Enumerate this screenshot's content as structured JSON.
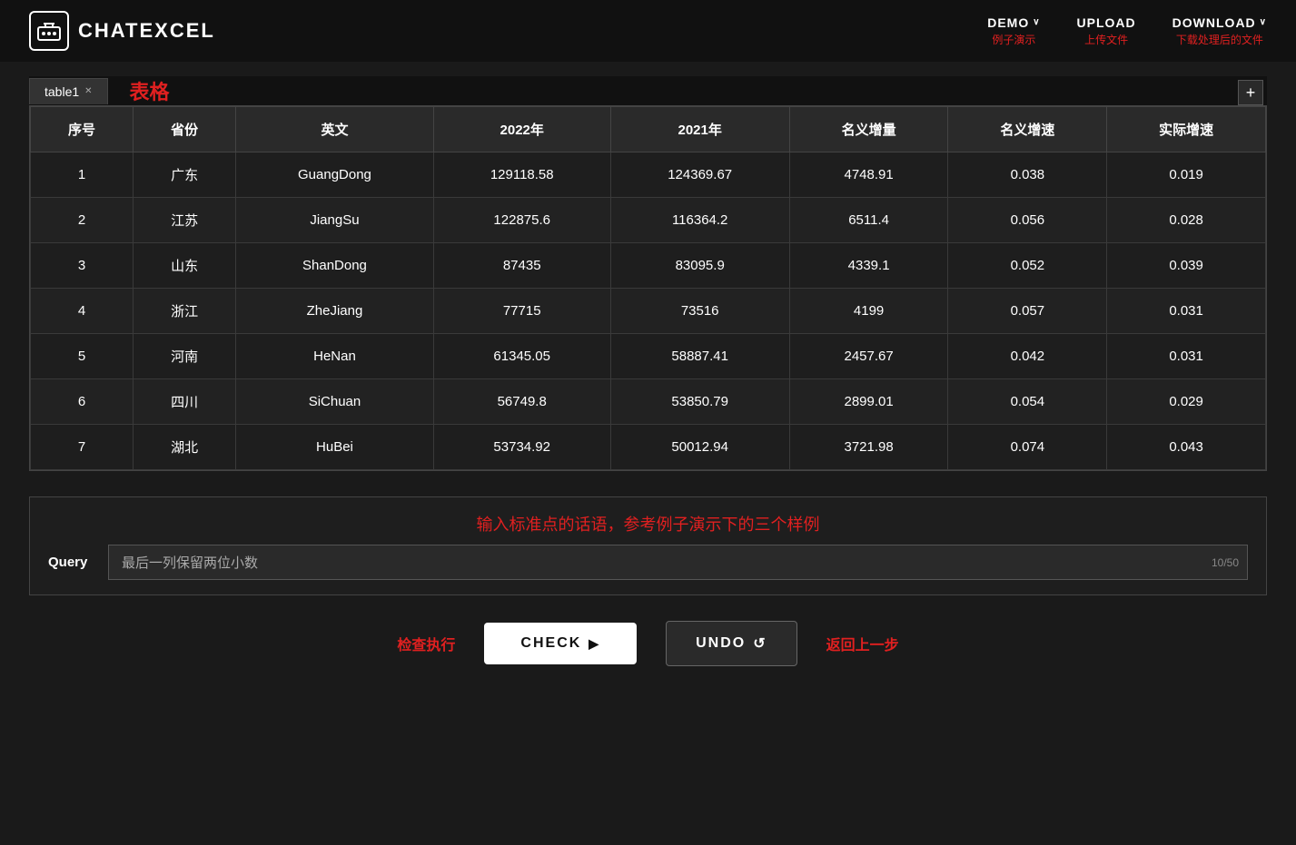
{
  "header": {
    "logo_text": "ChatExcel",
    "nav": [
      {
        "id": "demo",
        "label": "DEMO",
        "has_chevron": true,
        "sub": "例子演示"
      },
      {
        "id": "upload",
        "label": "UPLOAD",
        "has_chevron": false,
        "sub": "上传文件"
      },
      {
        "id": "download",
        "label": "DOWNLOAD",
        "has_chevron": true,
        "sub": "下载处理后的文件"
      }
    ]
  },
  "tabs": [
    {
      "id": "table1",
      "label": "table1",
      "active": true
    }
  ],
  "section_title": "表格",
  "add_tab_label": "+",
  "table": {
    "columns": [
      "序号",
      "省份",
      "英文",
      "2022年",
      "2021年",
      "名义增量",
      "名义增速",
      "实际增速"
    ],
    "rows": [
      [
        "1",
        "广东",
        "GuangDong",
        "129118.58",
        "124369.67",
        "4748.91",
        "0.038",
        "0.019"
      ],
      [
        "2",
        "江苏",
        "JiangSu",
        "122875.6",
        "116364.2",
        "6511.4",
        "0.056",
        "0.028"
      ],
      [
        "3",
        "山东",
        "ShanDong",
        "87435",
        "83095.9",
        "4339.1",
        "0.052",
        "0.039"
      ],
      [
        "4",
        "浙江",
        "ZheJiang",
        "77715",
        "73516",
        "4199",
        "0.057",
        "0.031"
      ],
      [
        "5",
        "河南",
        "HeNan",
        "61345.05",
        "58887.41",
        "2457.67",
        "0.042",
        "0.031"
      ],
      [
        "6",
        "四川",
        "SiChuan",
        "56749.8",
        "53850.79",
        "2899.01",
        "0.054",
        "0.029"
      ],
      [
        "7",
        "湖北",
        "HuBei",
        "53734.92",
        "50012.94",
        "3721.98",
        "0.074",
        "0.043"
      ]
    ]
  },
  "query": {
    "label": "Query",
    "hint": "输入标准点的话语，参考例子演示下的三个样例",
    "value": "最后一列保留两位小数",
    "counter": "10/50"
  },
  "actions": {
    "check_label_left": "检查执行",
    "check_btn": "CHECK",
    "check_icon": "▶",
    "undo_btn": "UNDO",
    "undo_icon": "↺",
    "undo_label_right": "返回上一步"
  }
}
